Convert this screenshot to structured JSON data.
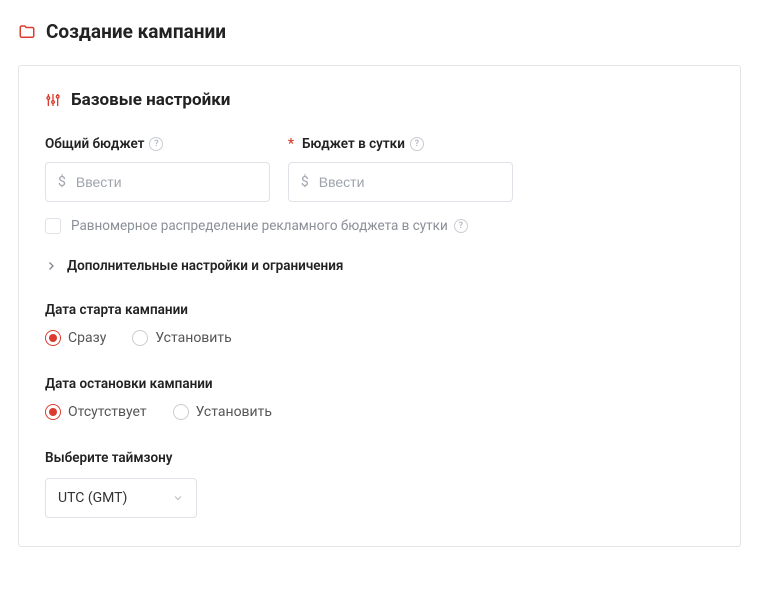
{
  "page": {
    "title": "Создание кампании"
  },
  "basic": {
    "title": "Базовые настройки",
    "total_budget": {
      "label": "Общий бюджет",
      "placeholder": "Ввести",
      "currency": "$"
    },
    "daily_budget": {
      "label": "Бюджет в сутки",
      "placeholder": "Ввести",
      "currency": "$"
    },
    "even_distribution": {
      "label": "Равномерное распределение рекламного бюджета в сутки",
      "checked": false
    },
    "expander": {
      "label": "Дополнительные настройки и ограничения"
    },
    "start_date": {
      "label": "Дата старта кампании",
      "options": {
        "now": "Сразу",
        "set": "Установить"
      },
      "selected": "now"
    },
    "stop_date": {
      "label": "Дата остановки кампании",
      "options": {
        "none": "Отсутствует",
        "set": "Установить"
      },
      "selected": "none"
    },
    "timezone": {
      "label": "Выберите таймзону",
      "value": "UTC (GMT)"
    }
  }
}
